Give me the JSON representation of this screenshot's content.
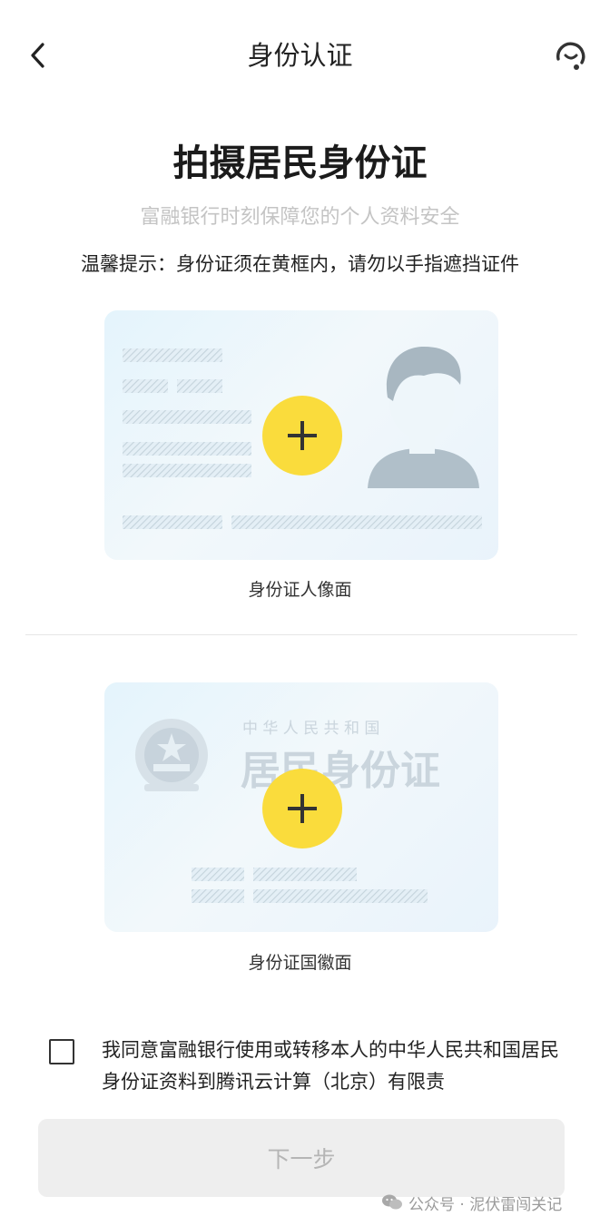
{
  "header": {
    "title": "身份认证",
    "back_icon": "chevron-left-icon",
    "support_icon": "customer-service-icon"
  },
  "main": {
    "title": "拍摄居民身份证",
    "subtitle": "富融银行时刻保障您的个人资料安全",
    "tip": "温馨提示：身份证须在黄框内，请勿以手指遮挡证件"
  },
  "cards": [
    {
      "caption": "身份证人像面",
      "action_icon": "plus-icon"
    },
    {
      "caption": "身份证国徽面",
      "action_icon": "plus-icon",
      "header_small": "中 华 人 民 共 和 国",
      "header_large": "居民身份证"
    }
  ],
  "consent": {
    "checked": false,
    "text": "我同意富融银行使用或转移本人的中华人民共和国居民身份证资料到腾讯云计算（北京）有限责"
  },
  "footer": {
    "next_label": "下一步",
    "watermark": "公众号 · 泥伏雷闯关记"
  },
  "colors": {
    "accent": "#fadc3c",
    "button_disabled_bg": "#eeeeee",
    "button_disabled_text": "#b5b5b5",
    "card_bg": "#e6f4fb"
  }
}
